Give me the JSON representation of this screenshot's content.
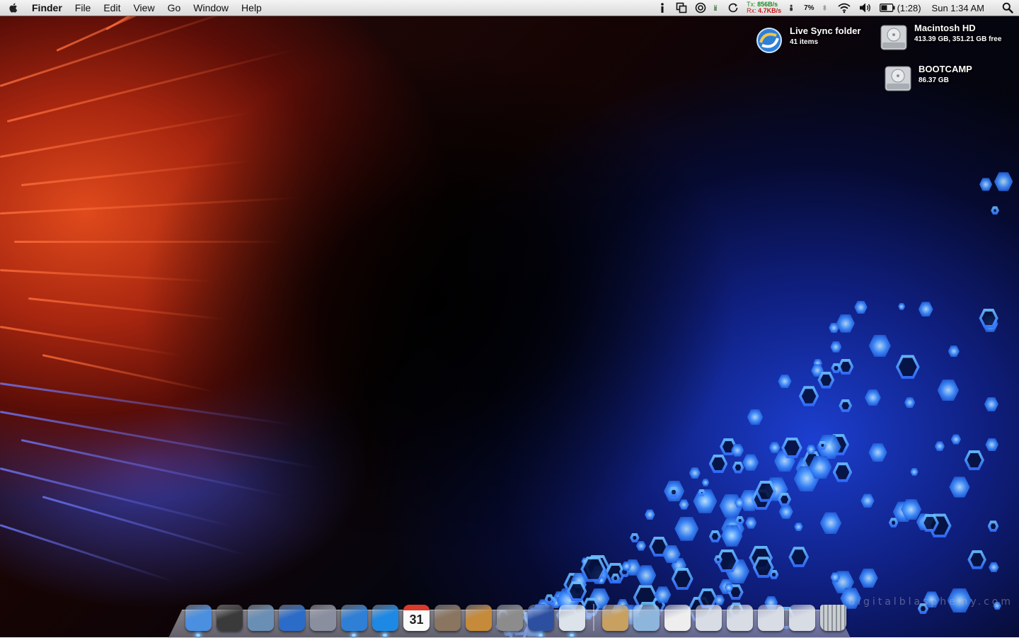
{
  "menubar": {
    "app_name": "Finder",
    "menus": [
      "File",
      "Edit",
      "View",
      "Go",
      "Window",
      "Help"
    ],
    "status": {
      "net_tx_label": "Tx:",
      "net_tx_value": "856B/s",
      "net_rx_label": "Rx:",
      "net_rx_value": "4.7KB/s",
      "cpu_percent": "7%",
      "battery_time": "(1:28)",
      "clock": "Sun 1:34 AM"
    }
  },
  "desktop_items": [
    {
      "name": "live-sync-folder",
      "title": "Live Sync folder",
      "sub": "41 items",
      "icon": "live-sync-icon"
    },
    {
      "name": "macintosh-hd",
      "title": "Macintosh HD",
      "sub": "413.39 GB, 351.21 GB free",
      "icon": "hard-drive-icon"
    },
    {
      "name": "bootcamp",
      "title": "BOOTCAMP",
      "sub": "86.37 GB",
      "icon": "hard-drive-icon"
    }
  ],
  "dock": {
    "apps": [
      {
        "name": "finder",
        "icon": "finder-icon",
        "running": true,
        "color": "#4a8fe0"
      },
      {
        "name": "dashboard",
        "icon": "dashboard-icon",
        "running": false,
        "color": "#3a3a3a"
      },
      {
        "name": "preview",
        "icon": "preview-icon",
        "running": false,
        "color": "#6a8fb5"
      },
      {
        "name": "thunderbird",
        "icon": "thunderbird-icon",
        "running": false,
        "color": "#2b6cc8"
      },
      {
        "name": "script-editor",
        "icon": "script-editor-icon",
        "running": false,
        "color": "#8a8fa0"
      },
      {
        "name": "safari",
        "icon": "safari-icon",
        "running": true,
        "color": "#2f7fd6"
      },
      {
        "name": "itunes",
        "icon": "itunes-icon",
        "running": true,
        "color": "#1e88e5"
      },
      {
        "name": "ical",
        "icon": "calendar-icon",
        "running": false,
        "color": "#f2f2f2",
        "day": "31"
      },
      {
        "name": "iphoto",
        "icon": "iphoto-icon",
        "running": false,
        "color": "#8a7560"
      },
      {
        "name": "image-capture",
        "icon": "image-capture-icon",
        "running": false,
        "color": "#c58a3a"
      },
      {
        "name": "system-preferences",
        "icon": "gear-icon",
        "running": false,
        "color": "#8c8c8c"
      },
      {
        "name": "vmware-fusion",
        "icon": "vmware-icon",
        "running": true,
        "color": "#2d4fa0"
      },
      {
        "name": "adium",
        "icon": "adium-icon",
        "running": true,
        "color": "#dde3ea"
      }
    ],
    "stacks": [
      {
        "name": "address-book",
        "icon": "address-book-icon",
        "color": "#c8a060"
      },
      {
        "name": "documents-folder",
        "icon": "folder-icon",
        "color": "#8eb6dd"
      },
      {
        "name": "text-document",
        "icon": "document-icon",
        "color": "#eeeeee"
      },
      {
        "name": "screenshot-1",
        "icon": "screenshot-icon",
        "color": "#d8dde5"
      },
      {
        "name": "screenshot-2",
        "icon": "screenshot-icon",
        "color": "#d8dde5"
      },
      {
        "name": "screenshot-3",
        "icon": "screenshot-icon",
        "color": "#d8dde5"
      },
      {
        "name": "screenshot-4",
        "icon": "screenshot-icon",
        "color": "#d8dde5"
      },
      {
        "name": "trash",
        "icon": "trash-icon",
        "color": "#b0b5ba"
      }
    ]
  },
  "watermark": "digitalblasphemy.com"
}
